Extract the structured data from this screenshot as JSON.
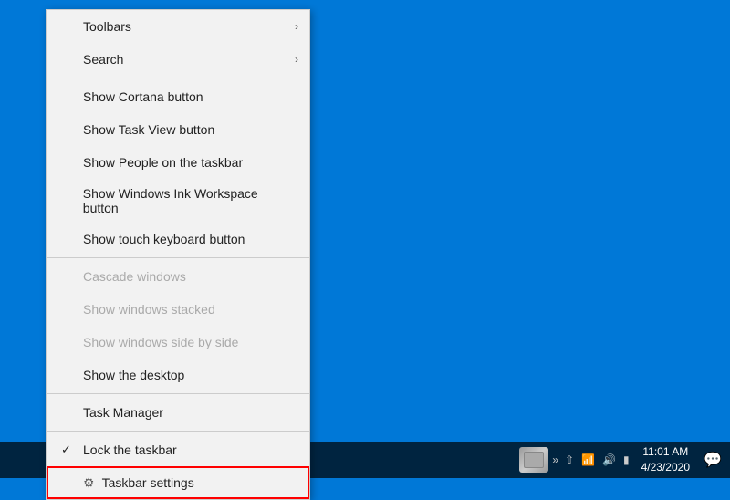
{
  "desktop": {
    "background_color": "#0078d7"
  },
  "context_menu": {
    "items": [
      {
        "id": "toolbars",
        "label": "Toolbars",
        "has_arrow": true,
        "disabled": false,
        "has_check": false,
        "has_icon": false,
        "separator_after": false
      },
      {
        "id": "search",
        "label": "Search",
        "has_arrow": true,
        "disabled": false,
        "has_check": false,
        "has_icon": false,
        "separator_after": true
      },
      {
        "id": "show-cortana",
        "label": "Show Cortana button",
        "has_arrow": false,
        "disabled": false,
        "has_check": false,
        "has_icon": false,
        "separator_after": false
      },
      {
        "id": "show-taskview",
        "label": "Show Task View button",
        "has_arrow": false,
        "disabled": false,
        "has_check": false,
        "has_icon": false,
        "separator_after": false
      },
      {
        "id": "show-people",
        "label": "Show People on the taskbar",
        "has_arrow": false,
        "disabled": false,
        "has_check": false,
        "has_icon": false,
        "separator_after": false
      },
      {
        "id": "show-ink",
        "label": "Show Windows Ink Workspace button",
        "has_arrow": false,
        "disabled": false,
        "has_check": false,
        "has_icon": false,
        "separator_after": false
      },
      {
        "id": "show-touch-keyboard",
        "label": "Show touch keyboard button",
        "has_arrow": false,
        "disabled": false,
        "has_check": false,
        "has_icon": false,
        "separator_after": true
      },
      {
        "id": "cascade-windows",
        "label": "Cascade windows",
        "has_arrow": false,
        "disabled": true,
        "has_check": false,
        "has_icon": false,
        "separator_after": false
      },
      {
        "id": "show-stacked",
        "label": "Show windows stacked",
        "has_arrow": false,
        "disabled": true,
        "has_check": false,
        "has_icon": false,
        "separator_after": false
      },
      {
        "id": "show-side-by-side",
        "label": "Show windows side by side",
        "has_arrow": false,
        "disabled": true,
        "has_check": false,
        "has_icon": false,
        "separator_after": false
      },
      {
        "id": "show-desktop",
        "label": "Show the desktop",
        "has_arrow": false,
        "disabled": false,
        "has_check": false,
        "has_icon": false,
        "separator_after": true
      },
      {
        "id": "task-manager",
        "label": "Task Manager",
        "has_arrow": false,
        "disabled": false,
        "has_check": false,
        "has_icon": false,
        "separator_after": true
      },
      {
        "id": "lock-taskbar",
        "label": "Lock the taskbar",
        "has_arrow": false,
        "disabled": false,
        "has_check": true,
        "has_icon": false,
        "separator_after": false
      },
      {
        "id": "taskbar-settings",
        "label": "Taskbar settings",
        "has_arrow": false,
        "disabled": false,
        "has_check": false,
        "has_icon": true,
        "separator_after": false,
        "highlighted": true
      }
    ]
  },
  "taskbar": {
    "time": "11:01 AM",
    "date": "4/23/2020",
    "chevron_label": "»",
    "notification_label": "💬"
  }
}
